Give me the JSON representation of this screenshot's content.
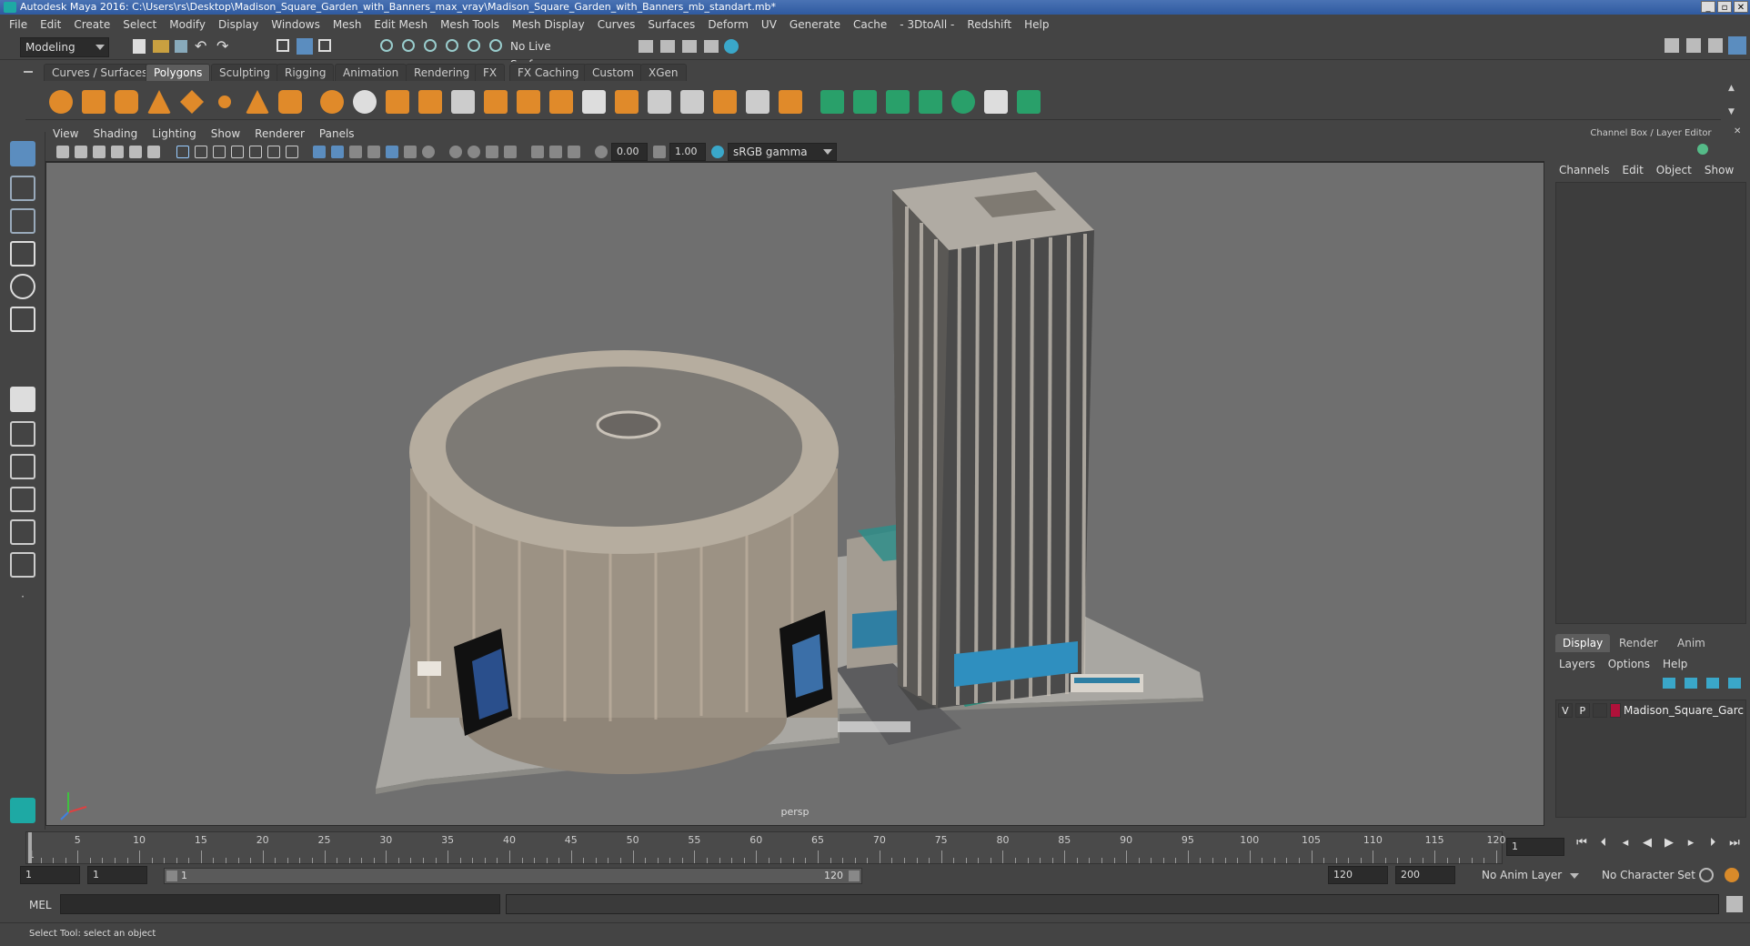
{
  "window": {
    "title": "Autodesk Maya 2016: C:\\Users\\rs\\Desktop\\Madison_Square_Garden_with_Banners_max_vray\\Madison_Square_Garden_with_Banners_mb_standart.mb*",
    "minimize": "_",
    "maximize": "▫",
    "close": "✕"
  },
  "menubar": [
    "File",
    "Edit",
    "Create",
    "Select",
    "Modify",
    "Display",
    "Windows",
    "Mesh",
    "Edit Mesh",
    "Mesh Tools",
    "Mesh Display",
    "Curves",
    "Surfaces",
    "Deform",
    "UV",
    "Generate",
    "Cache",
    "- 3DtoAll -",
    "Redshift",
    "Help"
  ],
  "status": {
    "mode": "Modeling",
    "live_surface": "No Live Surface"
  },
  "shelf_tabs": [
    {
      "label": "Curves / Surfaces"
    },
    {
      "label": "Polygons",
      "active": true
    },
    {
      "label": "Sculpting"
    },
    {
      "label": "Rigging"
    },
    {
      "label": "Animation"
    },
    {
      "label": "Rendering"
    },
    {
      "label": "FX"
    },
    {
      "label": "FX Caching"
    },
    {
      "label": "Custom"
    },
    {
      "label": "XGen"
    }
  ],
  "viewport": {
    "menu": [
      "View",
      "Shading",
      "Lighting",
      "Show",
      "Renderer",
      "Panels"
    ],
    "exposure": "0.00",
    "gamma": "1.00",
    "colorspace": "sRGB gamma",
    "camera_label": "persp"
  },
  "channel_box": {
    "title": "Channel Box / Layer Editor",
    "menu": [
      "Channels",
      "Edit",
      "Object",
      "Show"
    ]
  },
  "layer_editor": {
    "tabs": [
      {
        "label": "Display",
        "active": true
      },
      {
        "label": "Render"
      },
      {
        "label": "Anim"
      }
    ],
    "menu": [
      "Layers",
      "Options",
      "Help"
    ],
    "layers": [
      {
        "v": "V",
        "p": "P",
        "color": "#b0113a",
        "name": "Madison_Square_Garc"
      }
    ]
  },
  "timeline": {
    "ticks": [
      "1",
      "5",
      "10",
      "15",
      "20",
      "25",
      "30",
      "35",
      "40",
      "45",
      "50",
      "55",
      "60",
      "65",
      "70",
      "75",
      "80",
      "85",
      "90",
      "95",
      "100",
      "105",
      "110",
      "115",
      "120"
    ],
    "current_frame": "1"
  },
  "range": {
    "start": "1",
    "current_start": "1",
    "range_start_label": "1",
    "range_end_label": "120",
    "end": "120",
    "max_end": "200",
    "anim_layer": "No Anim Layer",
    "character_set": "No Character Set"
  },
  "command": {
    "label": "MEL"
  },
  "help_line": "Select Tool: select an object"
}
